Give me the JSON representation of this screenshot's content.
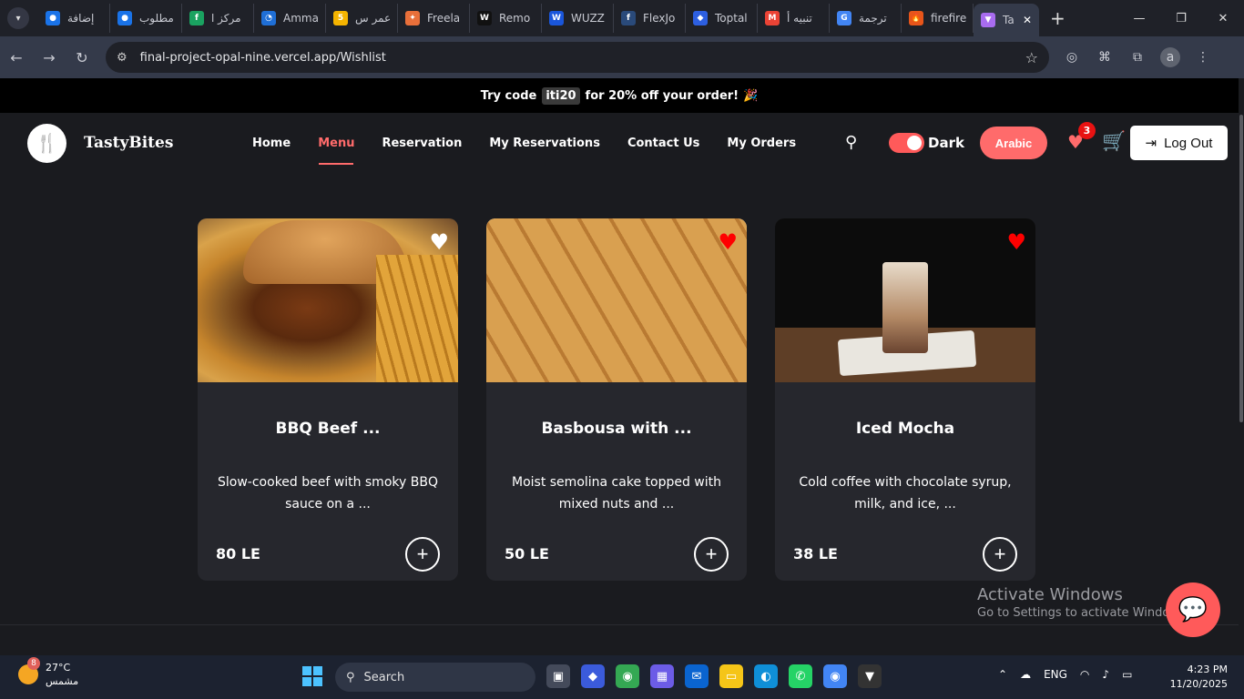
{
  "browser": {
    "tabs": [
      {
        "label": "إضافة",
        "fav_color": "#1a73e8",
        "fav_glyph": "●"
      },
      {
        "label": "مطلوب",
        "fav_color": "#1a73e8",
        "fav_glyph": "●"
      },
      {
        "label": "مركز ا",
        "fav_color": "#1aa260",
        "fav_glyph": "f"
      },
      {
        "label": "Amma",
        "fav_color": "#1f6fd6",
        "fav_glyph": "◔"
      },
      {
        "label": "عمر س",
        "fav_color": "#f5b400",
        "fav_glyph": "5"
      },
      {
        "label": "Freela",
        "fav_color": "#e86f3a",
        "fav_glyph": "✦"
      },
      {
        "label": "Remo",
        "fav_color": "#111111",
        "fav_glyph": "W"
      },
      {
        "label": "WUZZ",
        "fav_color": "#1a56db",
        "fav_glyph": "W"
      },
      {
        "label": "FlexJo",
        "fav_color": "#2a4a7a",
        "fav_glyph": "f"
      },
      {
        "label": "Toptal",
        "fav_color": "#2d5fe0",
        "fav_glyph": "◆"
      },
      {
        "label": "تنبيه أ",
        "fav_color": "#ea4335",
        "fav_glyph": "M"
      },
      {
        "label": "ترجمة",
        "fav_color": "#4285f4",
        "fav_glyph": "G"
      },
      {
        "label": "firefire",
        "fav_color": "#e8551a",
        "fav_glyph": "🔥"
      }
    ],
    "active_tab": {
      "label": "Ta",
      "fav_color": "#a86cf0",
      "fav_glyph": "▼"
    },
    "url": "final-project-opal-nine.vercel.app/Wishlist",
    "profile_initial": "a"
  },
  "promo": {
    "prefix": "Try code",
    "code": "iti20",
    "suffix": "for 20% off your order!",
    "emoji": "🎉"
  },
  "header": {
    "brand": "TastyBites",
    "nav": [
      {
        "label": "Home",
        "active": false
      },
      {
        "label": "Menu",
        "active": true
      },
      {
        "label": "Reservation",
        "active": false
      },
      {
        "label": "My Reservations",
        "active": false
      },
      {
        "label": "Contact Us",
        "active": false
      },
      {
        "label": "My Orders",
        "active": false
      }
    ],
    "theme_label": "Dark",
    "language_button": "Arabic",
    "wishlist_count": "3",
    "logout_label": "Log Out",
    "accent_color": "#ff6b6b"
  },
  "wishlist": [
    {
      "title": "BBQ Beef ...",
      "description": "Slow-cooked beef with smoky BBQ sauce on a ...",
      "price": "80 LE",
      "favorited": false,
      "image": "bbq-beef-burger-with-fries"
    },
    {
      "title": "Basbousa with ...",
      "description": "Moist semolina cake topped with mixed nuts and ...",
      "price": "50 LE",
      "favorited": true,
      "image": "basbousa-squares"
    },
    {
      "title": "Iced Mocha",
      "description": "Cold coffee with chocolate syrup, milk, and ice, ...",
      "price": "38 LE",
      "favorited": true,
      "image": "iced-mocha-glass"
    }
  ],
  "watermark": {
    "line1": "Activate Windows",
    "line2": "Go to Settings to activate Windows."
  },
  "taskbar": {
    "weather_temp": "27°C",
    "weather_desc": "مشمس",
    "weather_badge": "8",
    "search_label": "Search",
    "language": "ENG",
    "time": "4:23 PM",
    "date": "11/20/2025"
  }
}
